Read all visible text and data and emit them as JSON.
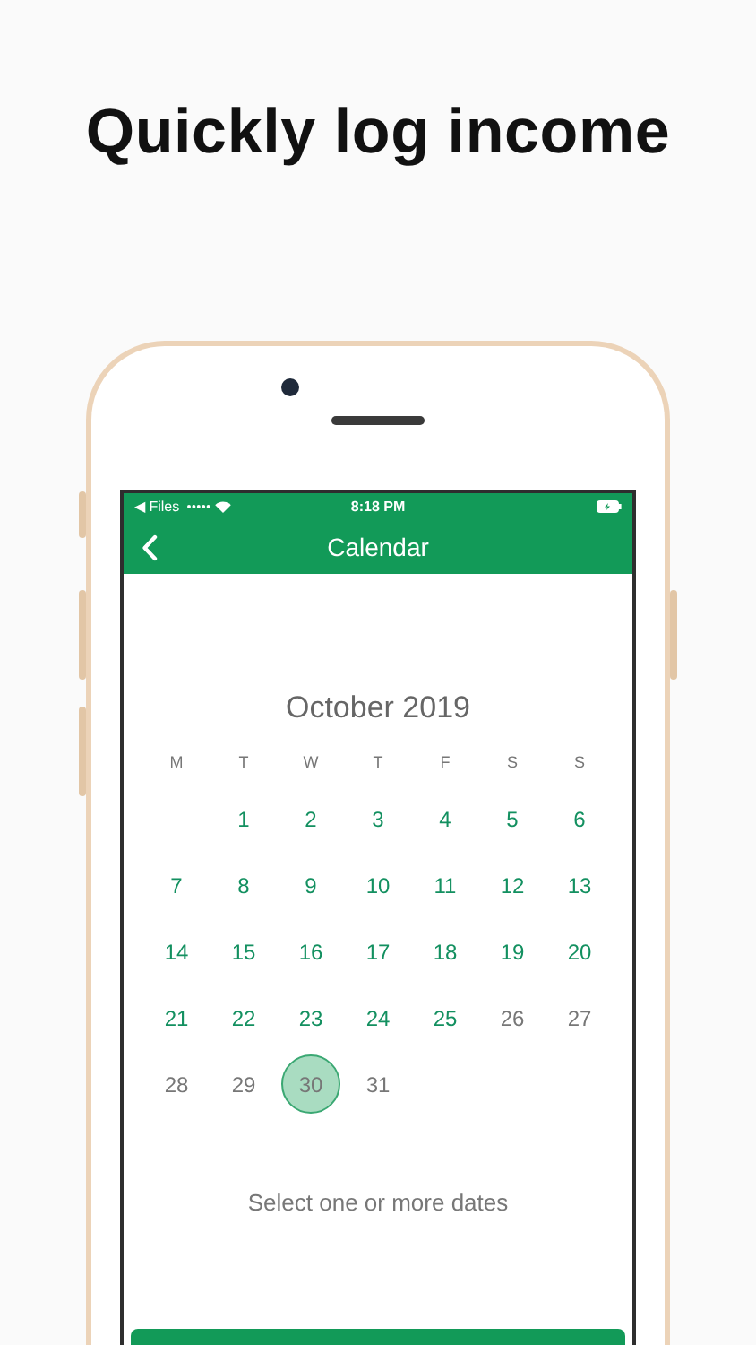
{
  "headline": "Quickly log income",
  "status_bar": {
    "back_label": "◀ Files",
    "time": "8:18 PM"
  },
  "nav": {
    "title": "Calendar"
  },
  "calendar": {
    "title": "October 2019",
    "weekdays": [
      "M",
      "T",
      "W",
      "T",
      "F",
      "S",
      "S"
    ],
    "weeks": [
      [
        {
          "day": "1",
          "disabled": false,
          "selected": false
        },
        {
          "day": "2",
          "disabled": false,
          "selected": false
        },
        {
          "day": "3",
          "disabled": false,
          "selected": false
        },
        {
          "day": "4",
          "disabled": false,
          "selected": false
        },
        {
          "day": "5",
          "disabled": false,
          "selected": false
        },
        {
          "day": "6",
          "disabled": false,
          "selected": false
        }
      ],
      [
        {
          "day": "7",
          "disabled": false,
          "selected": false
        },
        {
          "day": "8",
          "disabled": false,
          "selected": false
        },
        {
          "day": "9",
          "disabled": false,
          "selected": false
        },
        {
          "day": "10",
          "disabled": false,
          "selected": false
        },
        {
          "day": "11",
          "disabled": false,
          "selected": false
        },
        {
          "day": "12",
          "disabled": false,
          "selected": false
        },
        {
          "day": "13",
          "disabled": false,
          "selected": false
        }
      ],
      [
        {
          "day": "14",
          "disabled": false,
          "selected": false
        },
        {
          "day": "15",
          "disabled": false,
          "selected": false
        },
        {
          "day": "16",
          "disabled": false,
          "selected": false
        },
        {
          "day": "17",
          "disabled": false,
          "selected": false
        },
        {
          "day": "18",
          "disabled": false,
          "selected": false
        },
        {
          "day": "19",
          "disabled": false,
          "selected": false
        },
        {
          "day": "20",
          "disabled": false,
          "selected": false
        }
      ],
      [
        {
          "day": "21",
          "disabled": false,
          "selected": false
        },
        {
          "day": "22",
          "disabled": false,
          "selected": false
        },
        {
          "day": "23",
          "disabled": false,
          "selected": false
        },
        {
          "day": "24",
          "disabled": false,
          "selected": false
        },
        {
          "day": "25",
          "disabled": false,
          "selected": false
        },
        {
          "day": "26",
          "disabled": true,
          "selected": false
        },
        {
          "day": "27",
          "disabled": true,
          "selected": false
        }
      ],
      [
        {
          "day": "28",
          "disabled": true,
          "selected": false
        },
        {
          "day": "29",
          "disabled": true,
          "selected": false
        },
        {
          "day": "30",
          "disabled": true,
          "selected": true
        },
        {
          "day": "31",
          "disabled": true,
          "selected": false
        }
      ]
    ],
    "hint": "Select one or more dates"
  }
}
